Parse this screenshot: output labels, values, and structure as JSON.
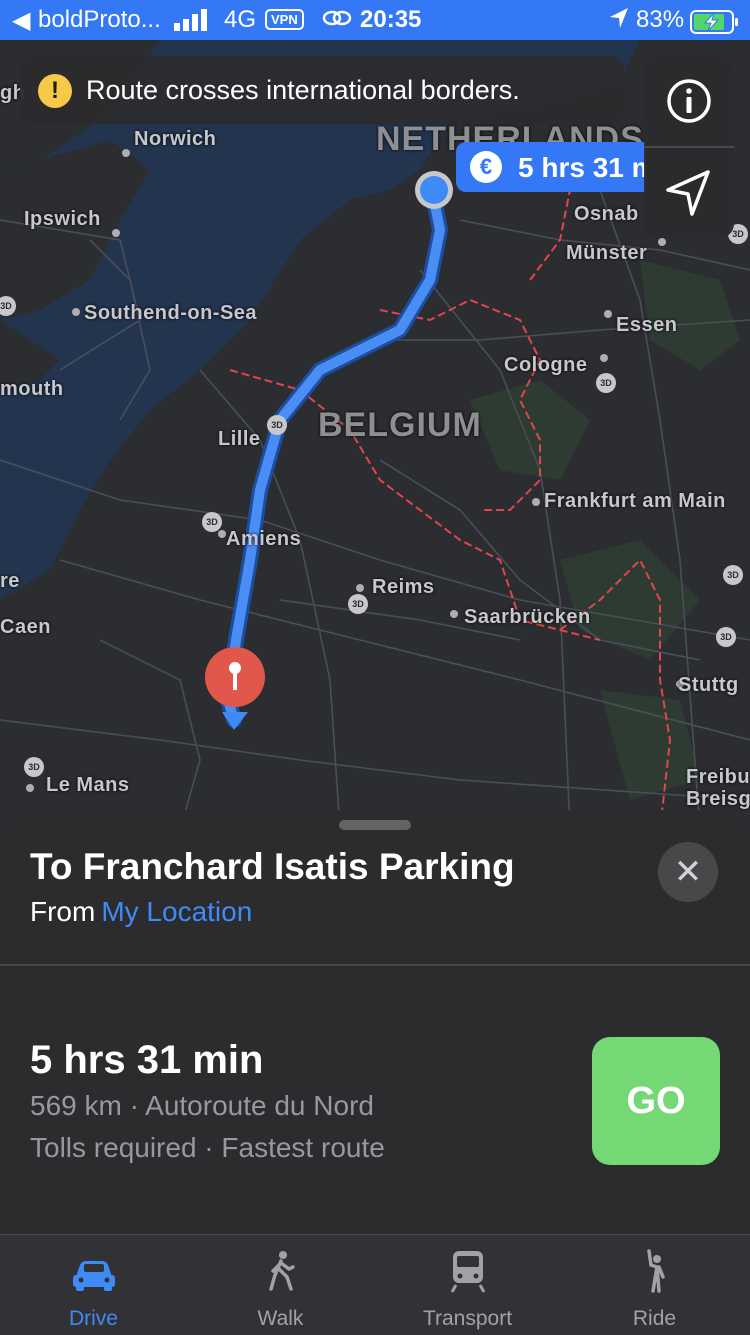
{
  "status_bar": {
    "back_arrow": "◀",
    "carrier": "boldProto...",
    "network": "4G",
    "vpn": "VPN",
    "time": "20:35",
    "battery": "83%"
  },
  "map": {
    "labels": {
      "norwich": "Norwich",
      "ipswich": "Ipswich",
      "southend": "Southend-on-Sea",
      "mouth": "mouth",
      "netherlands": "NETHERLANDS",
      "osnab": "Osnab",
      "munster": "Münster",
      "essen": "Essen",
      "cologne": "Cologne",
      "belgium": "BELGIUM",
      "lille": "Lille",
      "frankfurt": "Frankfurt am Main",
      "amiens": "Amiens",
      "reims": "Reims",
      "saarbrucken": "Saarbrücken",
      "re": "re",
      "caen": "Caen",
      "stuttg": "Stuttg",
      "le_mans": "Le Mans",
      "freibu": "Freibu",
      "breisg": "Breisg",
      "gh": "gh"
    },
    "badge_3d": "3D"
  },
  "warning": {
    "icon": "!",
    "text": "Route crosses international borders."
  },
  "route_tag": {
    "currency": "€",
    "duration": "5 hrs 31 m"
  },
  "sheet": {
    "title": "To Franchard Isatis Parking",
    "from_label": "From",
    "from_value": "My Location",
    "close": "✕",
    "eta": "5 hrs 31 min",
    "detail_line1": "569 km · Autoroute du Nord",
    "detail_line2": "Tolls required · Fastest route",
    "go": "GO"
  },
  "tabs": [
    {
      "label": "Drive",
      "icon": "car-icon",
      "active": true
    },
    {
      "label": "Walk",
      "icon": "walk-icon",
      "active": false
    },
    {
      "label": "Transport",
      "icon": "train-icon",
      "active": false
    },
    {
      "label": "Ride",
      "icon": "ride-icon",
      "active": false
    }
  ],
  "colors": {
    "accent": "#3478f6",
    "route": "#4a8ef5",
    "go": "#74d874",
    "pin": "#e2574c",
    "border": "#e0464b"
  }
}
